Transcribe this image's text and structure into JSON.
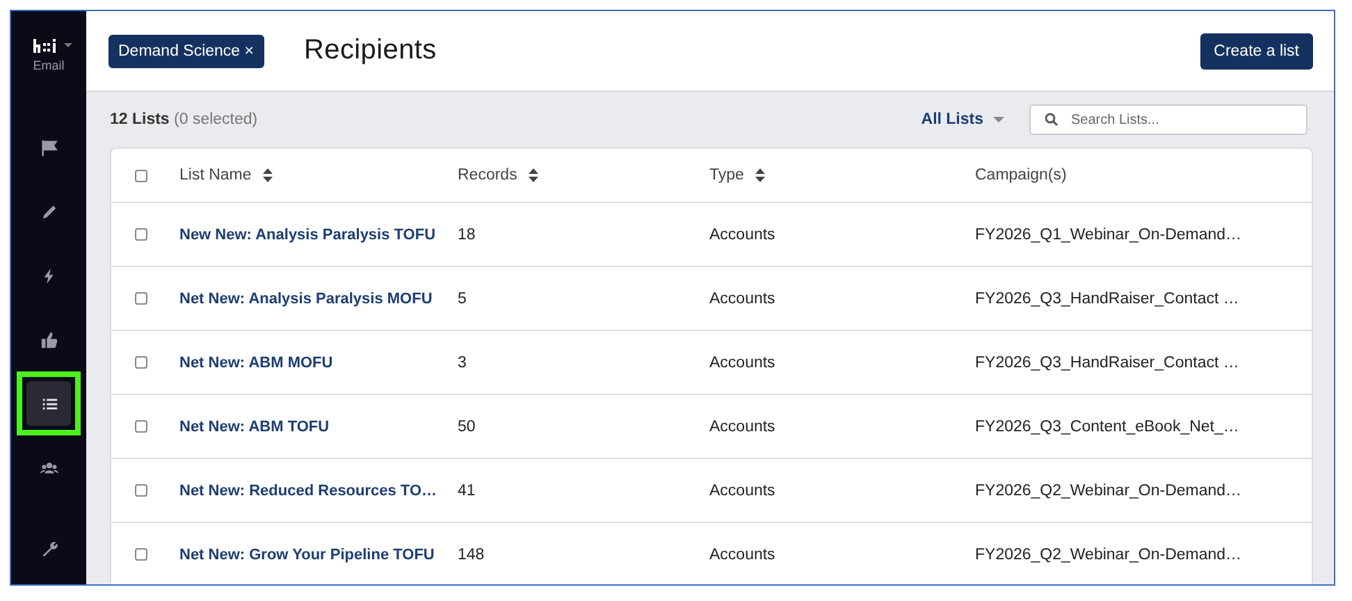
{
  "sidebar": {
    "app_label": "Email",
    "items": [
      {
        "kind": "flag",
        "selected": false,
        "highlighted": false
      },
      {
        "kind": "pencil",
        "selected": false,
        "highlighted": false
      },
      {
        "kind": "bolt",
        "selected": false,
        "highlighted": false
      },
      {
        "kind": "thumbs",
        "selected": false,
        "highlighted": false
      },
      {
        "kind": "list",
        "selected": true,
        "highlighted": true
      },
      {
        "kind": "people",
        "selected": false,
        "highlighted": false
      },
      {
        "kind": "wrench",
        "selected": false,
        "highlighted": false
      }
    ]
  },
  "header": {
    "filter_chip": "Demand Science ×",
    "title": "Recipients",
    "create_button": "Create a list"
  },
  "toolbar": {
    "count": "12 Lists",
    "selection": "(0 selected)",
    "filter": "All Lists",
    "search": {
      "placeholder": "Search Lists..."
    }
  },
  "table": {
    "select_all": {
      "checked": false
    },
    "columns": [
      {
        "label": "List Name",
        "sortable": true
      },
      {
        "label": "Records",
        "sortable": true
      },
      {
        "label": "Type",
        "sortable": true
      },
      {
        "label": "Campaign(s)",
        "sortable": false
      }
    ],
    "rows": [
      {
        "checked": false,
        "name": "New New: Analysis Paralysis TOFU",
        "records": "18",
        "type": "Accounts",
        "campaigns": "FY2026_Q1_Webinar_On-Demand…"
      },
      {
        "checked": false,
        "name": "Net New: Analysis Paralysis MOFU",
        "records": "5",
        "type": "Accounts",
        "campaigns": "FY2026_Q3_HandRaiser_Contact …"
      },
      {
        "checked": false,
        "name": "Net New: ABM MOFU",
        "records": "3",
        "type": "Accounts",
        "campaigns": "FY2026_Q3_HandRaiser_Contact …"
      },
      {
        "checked": false,
        "name": "Net New: ABM TOFU",
        "records": "50",
        "type": "Accounts",
        "campaigns": "FY2026_Q3_Content_eBook_Net_…"
      },
      {
        "checked": false,
        "name": "Net New: Reduced Resources TO…",
        "records": "41",
        "type": "Accounts",
        "campaigns": "FY2026_Q2_Webinar_On-Demand…"
      },
      {
        "checked": false,
        "name": "Net New: Grow Your Pipeline TOFU",
        "records": "148",
        "type": "Accounts",
        "campaigns": "FY2026_Q2_Webinar_On-Demand…"
      }
    ]
  }
}
